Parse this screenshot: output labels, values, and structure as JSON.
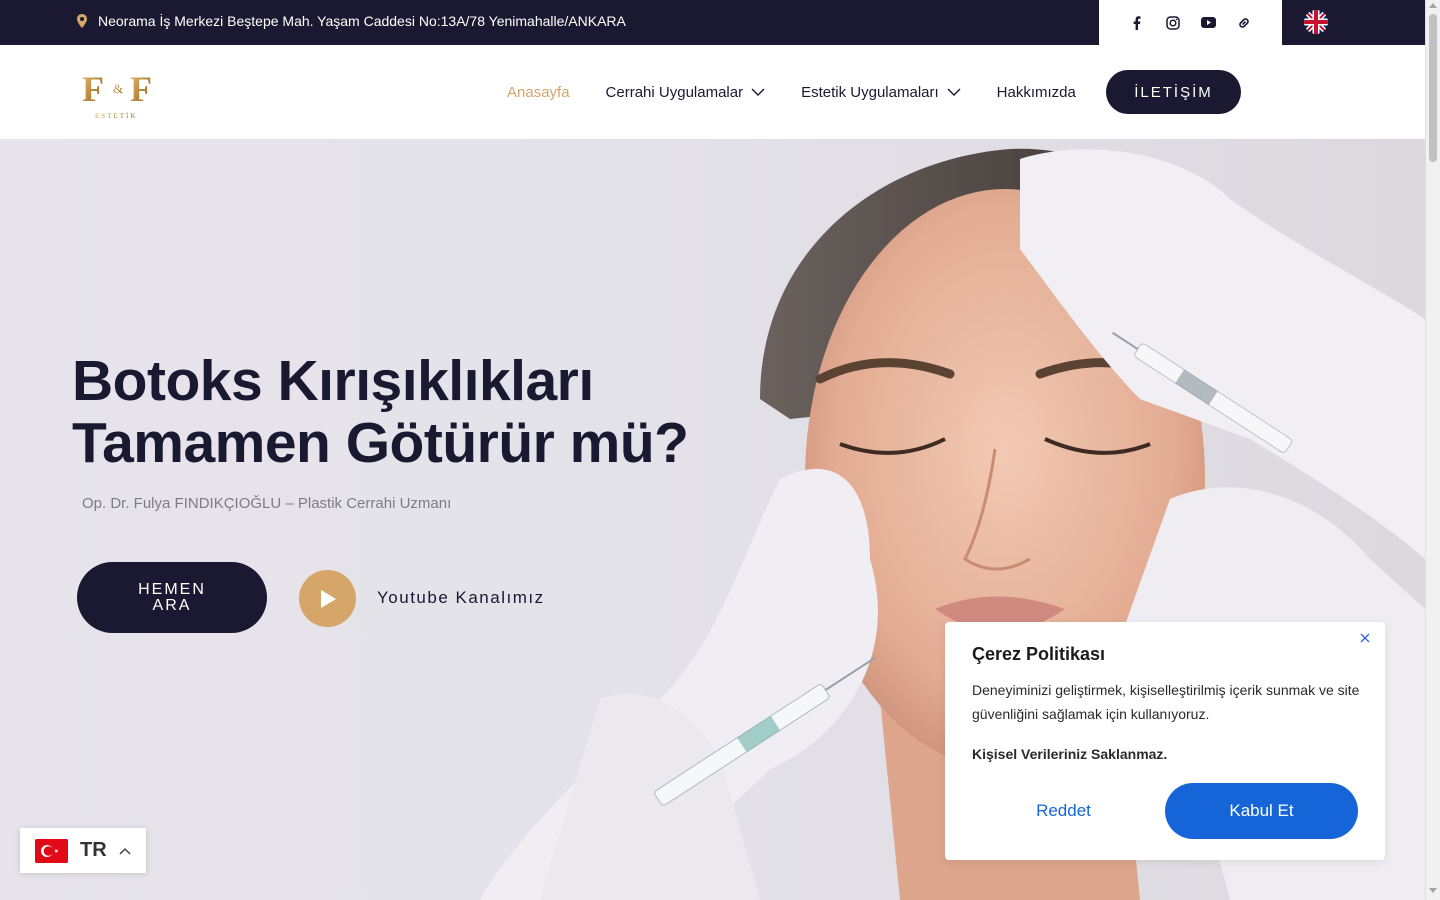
{
  "topbar": {
    "address": "Neorama İş Merkezi Beştepe Mah. Yaşam Caddesi No:13A/78 Yenimahalle/ANKARA",
    "social_icons": [
      "facebook-icon",
      "instagram-icon",
      "youtube-icon",
      "link-icon"
    ],
    "language_flag": "uk-flag-icon"
  },
  "header": {
    "logo_text": "F&F",
    "logo_subtext": "ESTETİK",
    "nav": [
      {
        "label": "Anasayfa",
        "active": true
      },
      {
        "label": "Cerrahi Uygulamalar",
        "dropdown": true
      },
      {
        "label": "Estetik Uygulamaları",
        "dropdown": true
      },
      {
        "label": "Hakkımızda"
      }
    ],
    "contact_label": "İLETİŞİM"
  },
  "hero": {
    "title_line1": "Botoks Kırışıklıkları",
    "title_line2": "Tamamen Götürür mü?",
    "subtitle": "Op. Dr. Fulya FINDIKÇIOĞLU – Plastik Cerrahi Uzmanı",
    "call_label_1": "HEMEN",
    "call_label_2": "ARA",
    "youtube_label": "Youtube Kanalımız"
  },
  "cookie": {
    "title": "Çerez Politikası",
    "text": "Deneyiminizi geliştirmek, kişiselleştirilmiş içerik sunmak ve site güvenliğini sağlamak için kullanıyoruz.",
    "note": "Kişisel Verileriniz Saklanmaz.",
    "reject_label": "Reddet",
    "accept_label": "Kabul Et"
  },
  "language_switcher": {
    "code": "TR"
  },
  "colors": {
    "navy": "#1b1831",
    "gold": "#d5a56a",
    "blue": "#1565d8"
  }
}
